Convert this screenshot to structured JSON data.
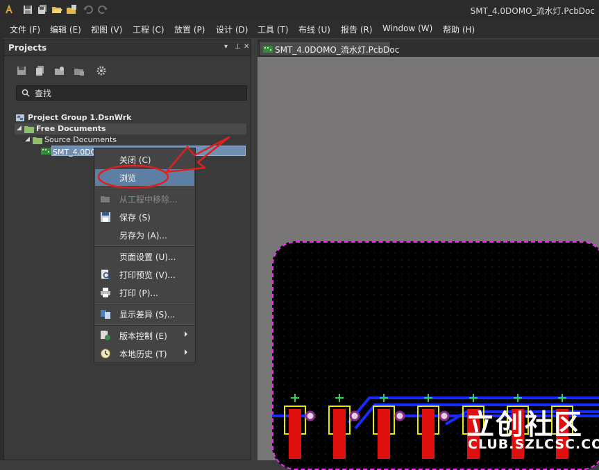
{
  "window": {
    "title": "SMT_4.0DOMO_流水灯.PcbDoc",
    "quick_access": [
      "app-logo-icon",
      "save-icon",
      "save-all-icon",
      "open-icon",
      "open-project-icon",
      "undo-icon",
      "redo-icon"
    ]
  },
  "menu": [
    "文件 (F)",
    "编辑 (E)",
    "视图 (V)",
    "工程 (C)",
    "放置 (P)",
    "设计 (D)",
    "工具 (T)",
    "布线 (U)",
    "报告 (R)",
    "Window (W)",
    "帮助 (H)"
  ],
  "projects_panel": {
    "title": "Projects",
    "header_controls": [
      "▾",
      "⊥",
      "✕"
    ],
    "toolbar_icons": [
      "save-project-icon",
      "save-document-icon",
      "open-project-icon",
      "open-folder-icon",
      "settings-icon"
    ],
    "search_placeholder": "查找",
    "tree": {
      "group": "Project Group 1.DsnWrk",
      "free_documents": "Free Documents",
      "source_documents": "Source Documents",
      "document": "SMT_4.0DOMO_流水灯.PcbDoc"
    }
  },
  "context_menu": {
    "items": [
      {
        "label": "关闭 (C)",
        "icon": ""
      },
      {
        "label": "浏览",
        "icon": "",
        "highlighted": true
      },
      {
        "label": "从工程中移除...",
        "icon": "remove-folder-icon",
        "disabled": true
      },
      {
        "label": "保存 (S)",
        "icon": "save-icon"
      },
      {
        "label": "另存为 (A)...",
        "icon": ""
      },
      {
        "label": "页面设置 (U)...",
        "icon": ""
      },
      {
        "label": "打印预览 (V)...",
        "icon": "print-preview-icon"
      },
      {
        "label": "打印 (P)...",
        "icon": "printer-icon"
      },
      {
        "label": "显示差异 (S)...",
        "icon": "compare-icon"
      },
      {
        "label": "版本控制 (E)",
        "icon": "version-control-icon",
        "submenu": true
      },
      {
        "label": "本地历史 (T)",
        "icon": "history-clock-icon",
        "submenu": true
      }
    ]
  },
  "document_tab": {
    "label": "SMT_4.0DOMO_流水灯.PcbDoc"
  },
  "watermark": {
    "main": "立创社区",
    "url": "CLUB.SZLCSC.COM"
  },
  "colors": {
    "board_outline": "#ff22ff",
    "track": "#1a2bff",
    "pad": "#e01010",
    "silkscreen": "#e8e800",
    "highlight": "#5d7fa3",
    "annotation_arrow": "#e02020"
  }
}
